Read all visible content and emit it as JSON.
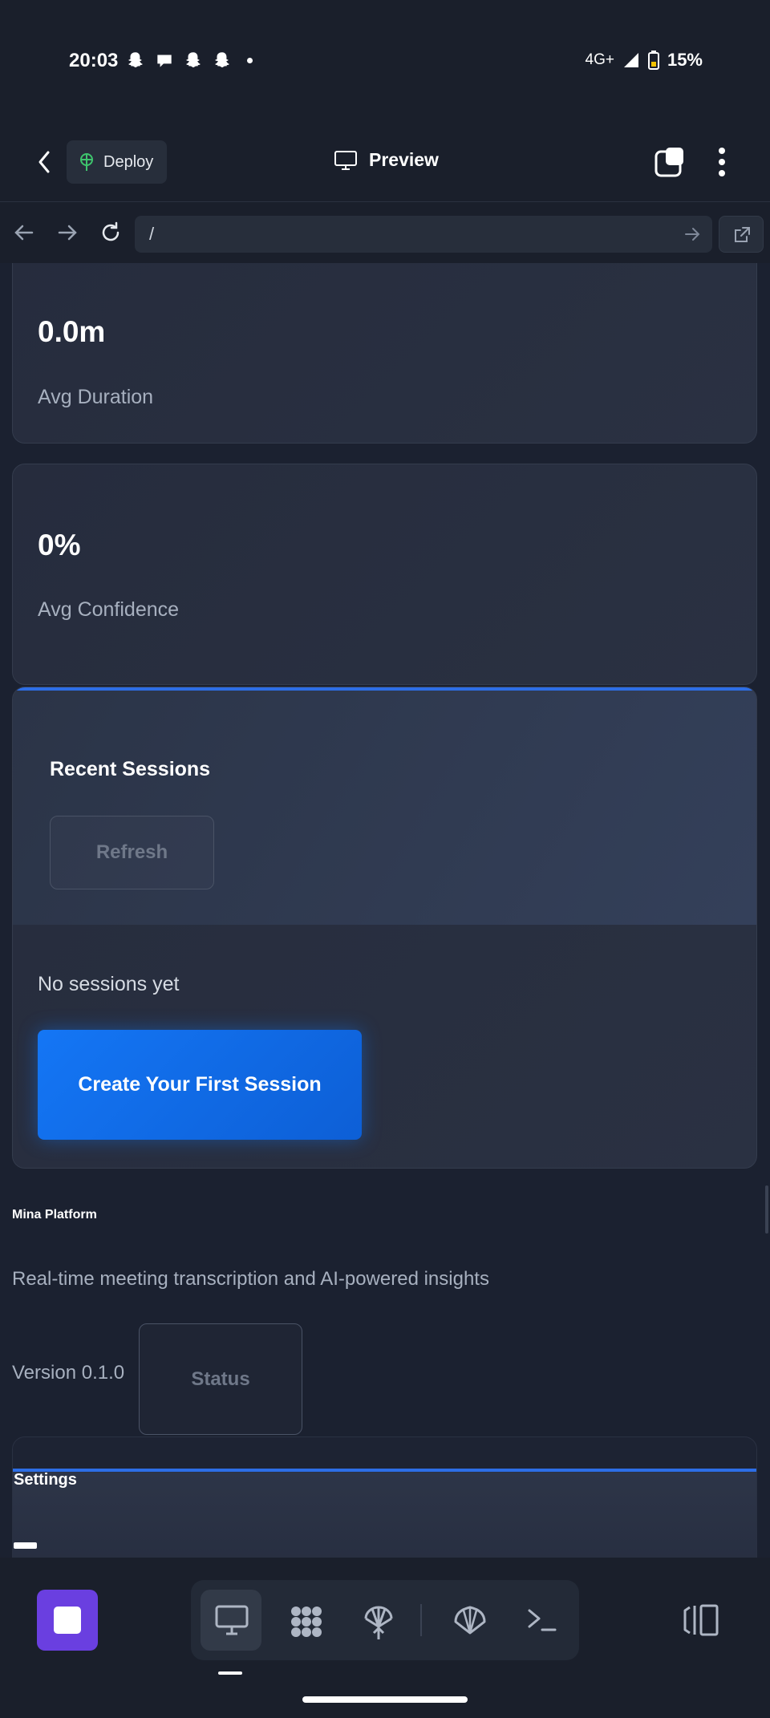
{
  "status_bar": {
    "time": "20:03",
    "network": "4G+",
    "battery": "15%"
  },
  "header": {
    "deploy_label": "Deploy",
    "preview_label": "Preview"
  },
  "browser": {
    "url": "/"
  },
  "stats": [
    {
      "value": "0.0m",
      "label": "Avg Duration"
    },
    {
      "value": "0%",
      "label": "Avg Confidence"
    }
  ],
  "sessions": {
    "title": "Recent Sessions",
    "refresh_label": "Refresh",
    "empty_text": "No sessions yet",
    "create_label": "Create Your First Session"
  },
  "footer": {
    "platform_name": "Mina Platform",
    "tagline": "Real-time meeting transcription and AI-powered insights",
    "version": "Version 0.1.0",
    "status_label": "Status"
  },
  "settings": {
    "title": "Settings"
  },
  "colors": {
    "accent": "#1476f5",
    "stop_button": "#6a3fe0",
    "background": "#1a1f2b"
  },
  "dock": {
    "items": [
      "monitor-icon",
      "apps-grid-icon",
      "deploy-icon",
      "shell-icon",
      "terminal-icon"
    ]
  }
}
